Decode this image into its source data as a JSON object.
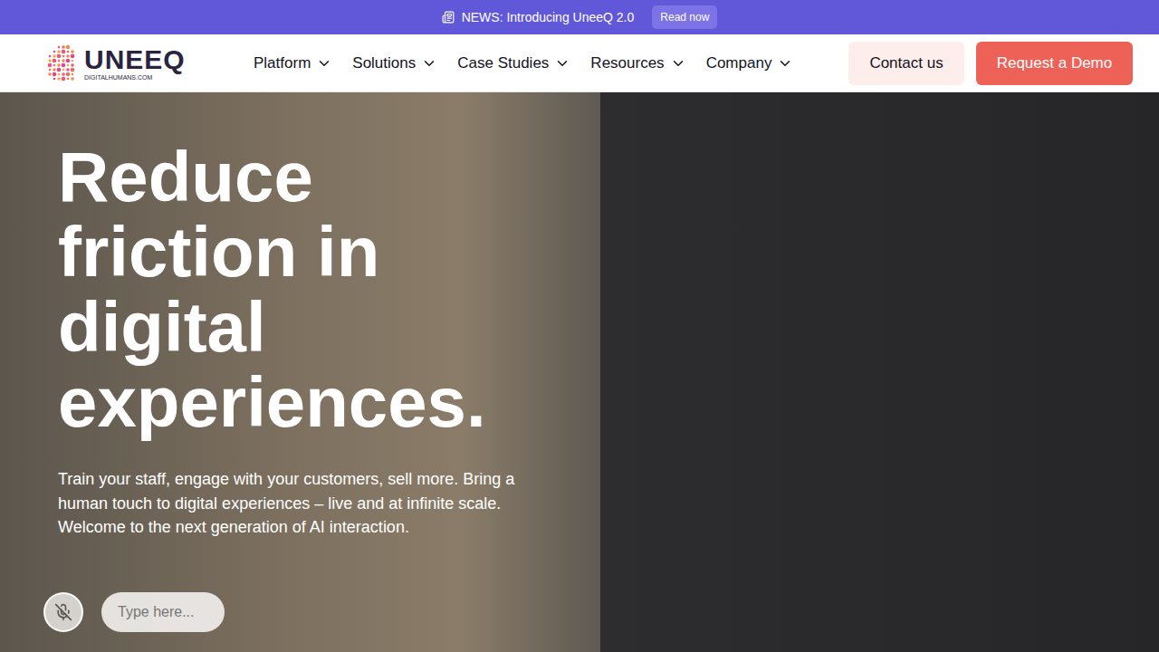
{
  "announcement": {
    "text": "NEWS: Introducing UneeQ 2.0",
    "button": "Read now"
  },
  "logo": {
    "word": "UNEEQ",
    "tagline": "DIGITALHUMANS.COM"
  },
  "nav": {
    "items": [
      {
        "label": "Platform"
      },
      {
        "label": "Solutions"
      },
      {
        "label": "Case Studies"
      },
      {
        "label": "Resources"
      },
      {
        "label": "Company"
      }
    ],
    "buttons": [
      {
        "label": "Contact us",
        "kind": "secondary"
      },
      {
        "label": "Request a Demo",
        "kind": "primary"
      }
    ]
  },
  "hero": {
    "title": "Reduce friction in digital experiences.",
    "subtitle": "Train your staff, engage with your customers, sell more. Bring a human touch to digital experiences – live and at infinite scale. Welcome to the next generation of AI interaction."
  },
  "chat": {
    "muted": true,
    "placeholder": "Type here..."
  }
}
